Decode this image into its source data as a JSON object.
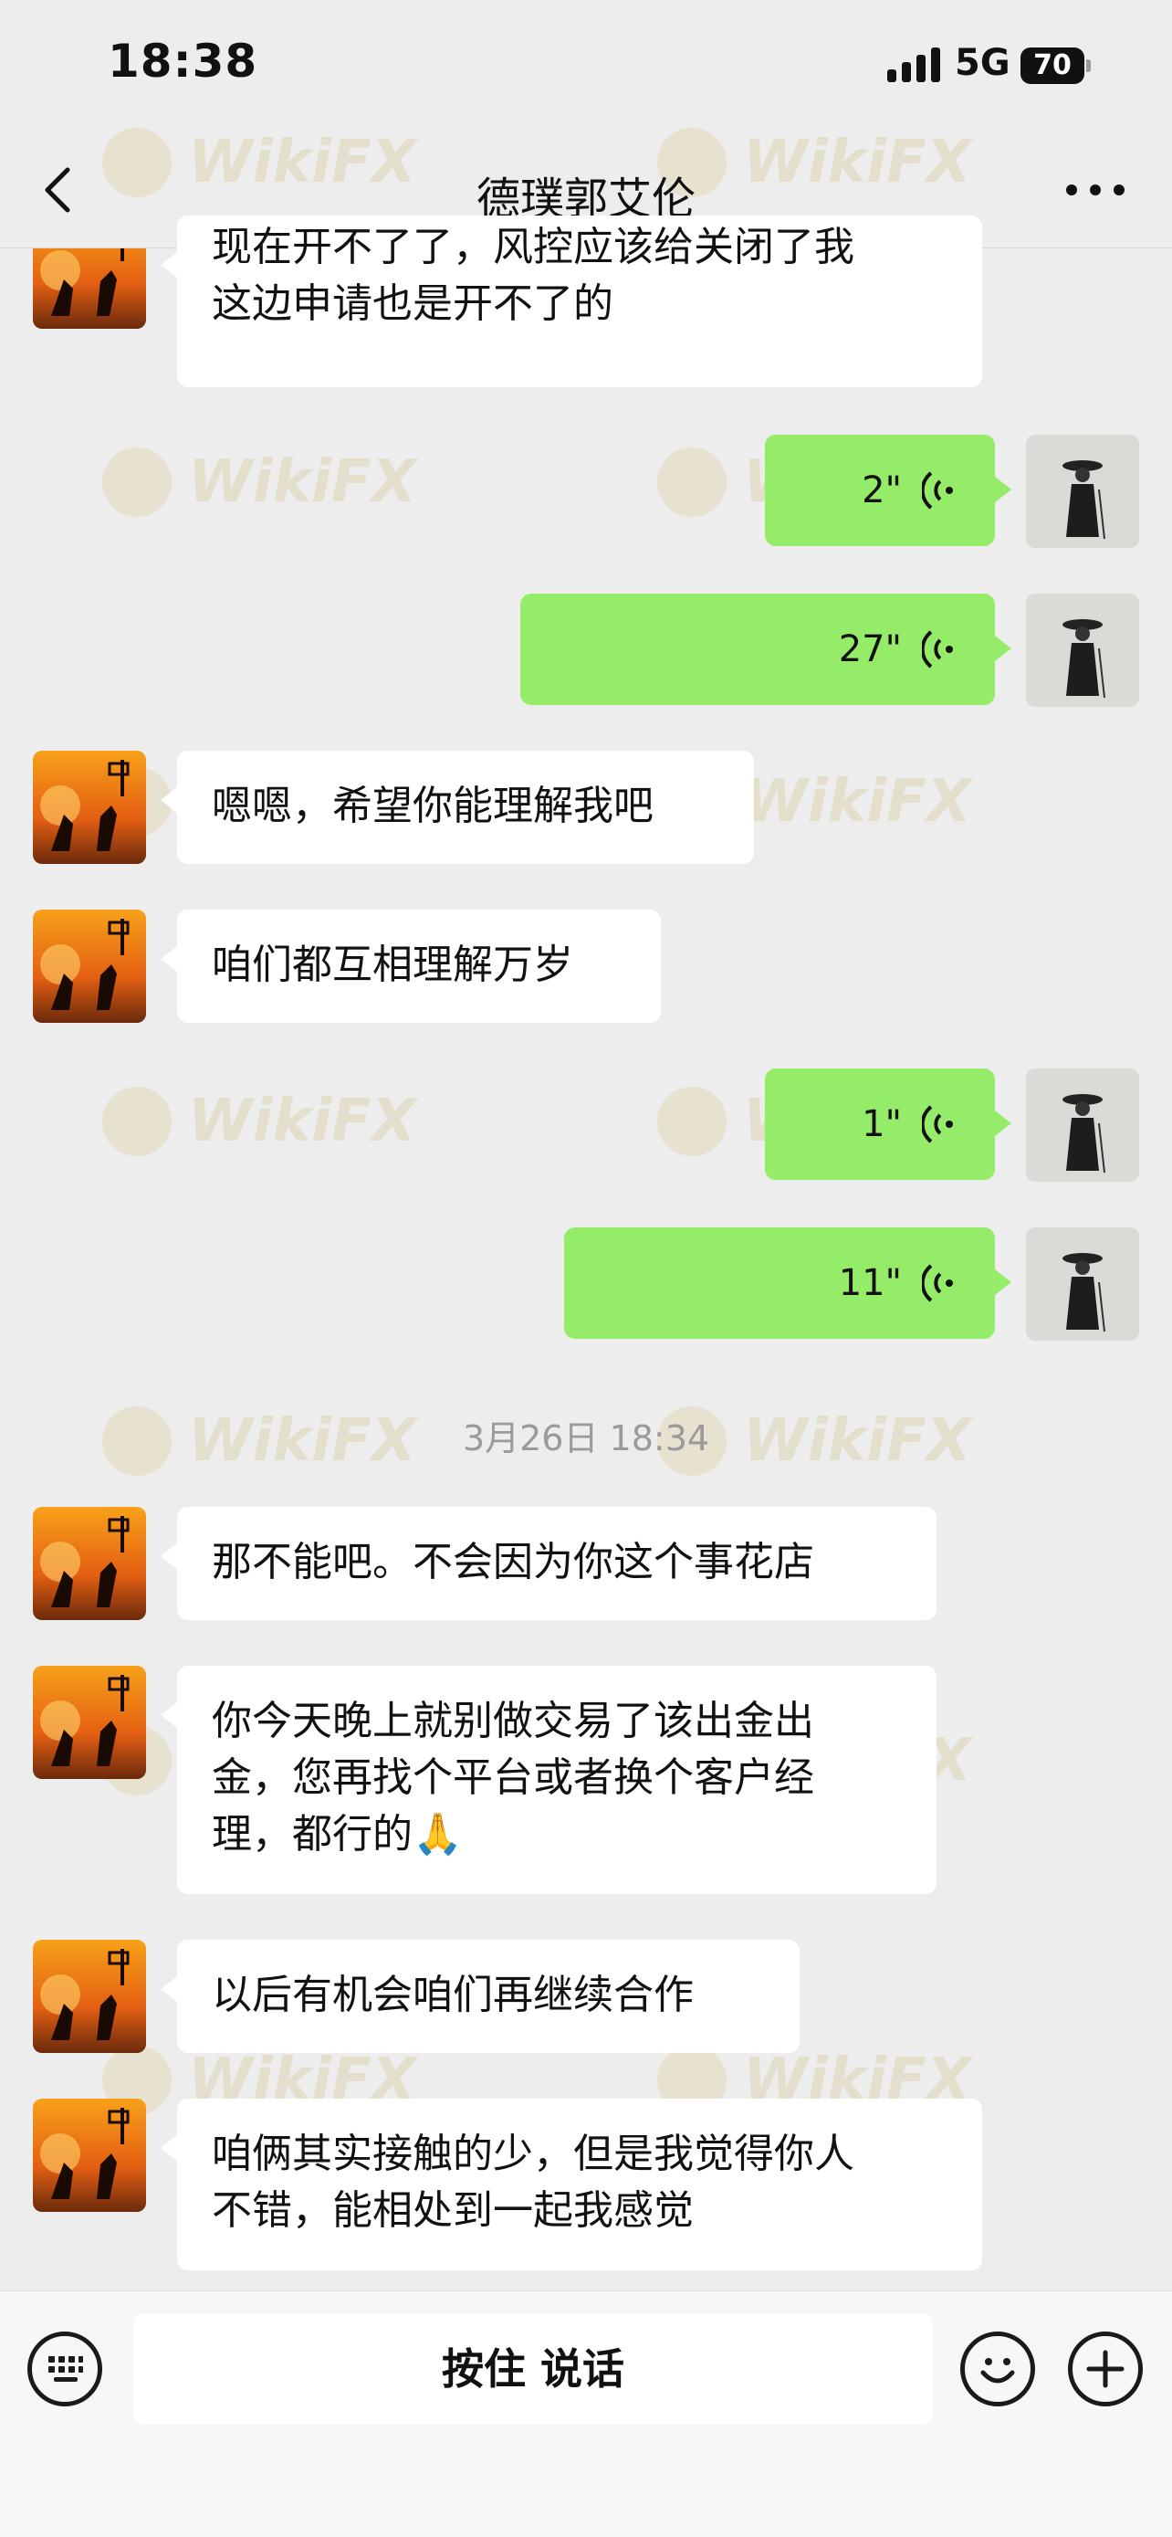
{
  "status_bar": {
    "time": "18:38",
    "network": "5G",
    "battery": "70"
  },
  "nav": {
    "title": "德璞郭艾伦"
  },
  "messages": [
    {
      "side": "in",
      "type": "text",
      "lines": [
        "现在开不了了，风控应该给关闭了我",
        "这边申请也是开不了的"
      ]
    },
    {
      "side": "out",
      "type": "voice",
      "duration": "2\""
    },
    {
      "side": "out",
      "type": "voice",
      "duration": "27\""
    },
    {
      "side": "in",
      "type": "text",
      "lines": [
        "嗯嗯，希望你能理解我吧"
      ]
    },
    {
      "side": "in",
      "type": "text",
      "lines": [
        "咱们都互相理解万岁"
      ]
    },
    {
      "side": "out",
      "type": "voice",
      "duration": "1\""
    },
    {
      "side": "out",
      "type": "voice",
      "duration": "11\""
    },
    {
      "type": "timestamp",
      "text": "3月26日 18:34"
    },
    {
      "side": "in",
      "type": "text",
      "lines": [
        "那不能吧。不会因为你这个事花店"
      ]
    },
    {
      "side": "in",
      "type": "text",
      "lines": [
        "你今天晚上就别做交易了该出金出",
        "金，您再找个平台或者换个客户经",
        "理，都行的🙏"
      ]
    },
    {
      "side": "in",
      "type": "text",
      "lines": [
        "以后有机会咱们再继续合作"
      ]
    },
    {
      "side": "in",
      "type": "text",
      "lines": [
        "咱俩其实接触的少，但是我觉得你人",
        "不错，能相处到一起我感觉"
      ]
    }
  ],
  "input": {
    "talk_label": "按住 说话"
  },
  "watermark": {
    "text": "WikiFX"
  },
  "colors": {
    "background": "#ededed",
    "outgoing_bubble": "#95ec69",
    "incoming_bubble": "#ffffff"
  },
  "icons": {
    "back": "chevron-left-icon",
    "more": "more-dots-icon",
    "voice": "voice-wave-icon",
    "keyboard": "keyboard-icon",
    "emoji": "emoji-icon",
    "plus": "plus-icon"
  }
}
